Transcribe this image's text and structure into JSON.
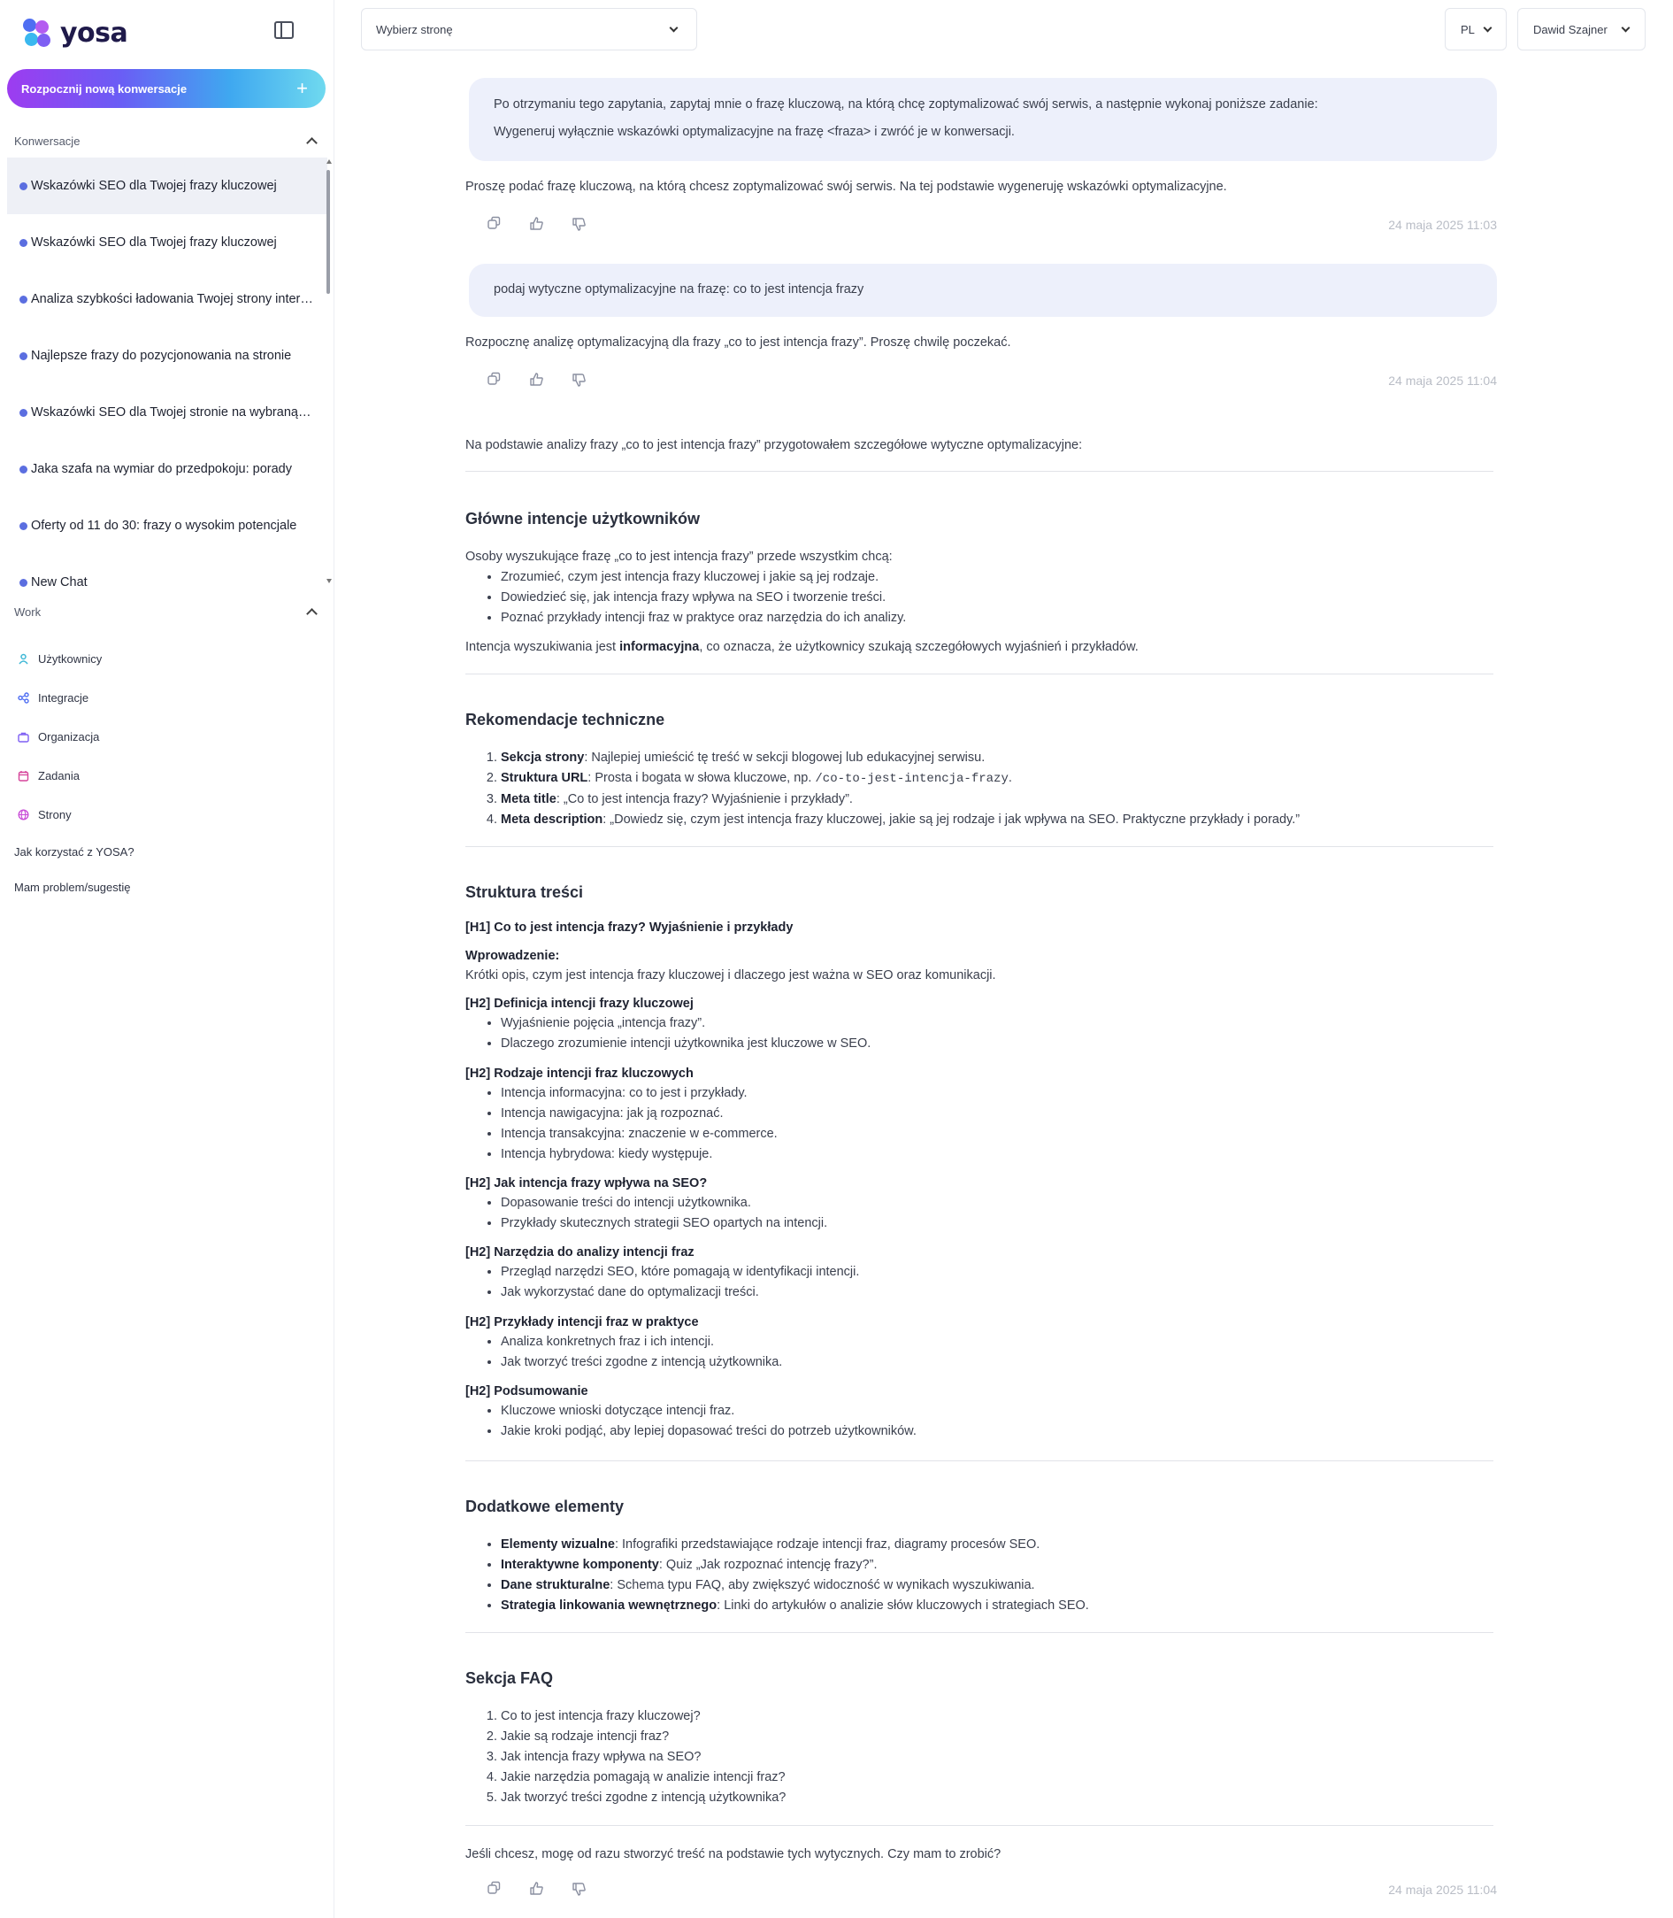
{
  "sidebar": {
    "logo_text": "yosa",
    "new_chat_label": "Rozpocznij nową konwersacje",
    "conversations_header": "Konwersacje",
    "conversations": [
      "Wskazówki SEO dla Twojej frazy kluczowej",
      "Wskazówki SEO dla Twojej frazy kluczowej",
      "Analiza szybkości ładowania Twojej strony internetowej",
      "Najlepsze frazy do pozycjonowania na stronie",
      "Wskazówki SEO dla Twojej stronie na wybraną frazę",
      "Jaka szafa na wymiar do przedpokoju: porady",
      "Oferty od 11 do 30: frazy o wysokim potencjale",
      "New Chat"
    ],
    "work_header": "Work",
    "work_items": [
      "Użytkownicy",
      "Integracje",
      "Organizacja",
      "Zadania",
      "Strony"
    ],
    "help_link": "Jak korzystać z YOSA?",
    "problem_link": "Mam problem/sugestię"
  },
  "header": {
    "page_select_placeholder": "Wybierz stronę",
    "lang": "PL",
    "user": "Dawid Szajner"
  },
  "chat": {
    "msg1_line1": "Po otrzymaniu tego zapytania, zapytaj mnie o frazę kluczową, na którą chcę zoptymalizować swój serwis, a następnie wykonaj poniższe zadanie:",
    "msg1_line2": "Wygeneruj wyłącznie wskazówki optymalizacyjne na frazę <fraza> i zwróć je w konwersacji.",
    "reply1": "Proszę podać frazę kluczową, na którą chcesz zoptymalizować swój serwis. Na tej podstawie wygeneruję wskazówki optymalizacyjne.",
    "time1": "24 maja 2025 11:03",
    "msg2": "podaj wytyczne optymalizacyjne na frazę: co to jest intencja frazy",
    "reply2": "Rozpocznę analizę optymalizacyjną dla frazy „co to jest intencja frazy”. Proszę chwilę poczekać.",
    "time2": "24 maja 2025 11:04",
    "intro": "Na podstawie analizy frazy „co to jest intencja frazy” przygotowałem szczegółowe wytyczne optymalizacyjne:",
    "s1_title": "Główne intencje użytkowników",
    "s1_lead": "Osoby wyszukujące frazę „co to jest intencja frazy” przede wszystkim chcą:",
    "s1_items": [
      "Zrozumieć, czym jest intencja frazy kluczowej i jakie są jej rodzaje.",
      "Dowiedzieć się, jak intencja frazy wpływa na SEO i tworzenie treści.",
      "Poznać przykłady intencji fraz w praktyce oraz narzędzia do ich analizy."
    ],
    "s1_tail_a": "Intencja wyszukiwania jest ",
    "s1_tail_b": "informacyjna",
    "s1_tail_c": ", co oznacza, że użytkownicy szukają szczegółowych wyjaśnień i przykładów.",
    "s2_title": "Rekomendacje techniczne",
    "s2_items": [
      {
        "k": "Sekcja strony",
        "v": ": Najlepiej umieścić tę treść w sekcji blogowej lub edukacyjnej serwisu."
      },
      {
        "k": "Struktura URL",
        "v": ": Prosta i bogata w słowa kluczowe, np. ",
        "code": "/co-to-jest-intencja-frazy",
        "end": "."
      },
      {
        "k": "Meta title",
        "v": ": „Co to jest intencja frazy? Wyjaśnienie i przykłady”."
      },
      {
        "k": "Meta description",
        "v": ": „Dowiedz się, czym jest intencja frazy kluczowej, jakie są jej rodzaje i jak wpływa na SEO. Praktyczne przykłady i porady.”"
      }
    ],
    "s3_title": "Struktura treści",
    "h1": "[H1] Co to jest intencja frazy? Wyjaśnienie i przykłady",
    "intro_label": "Wprowadzenie:",
    "intro_text": "Krótki opis, czym jest intencja frazy kluczowej i dlaczego jest ważna w SEO oraz komunikacji.",
    "h2_blocks": [
      {
        "title": "[H2] Definicja intencji frazy kluczowej",
        "items": [
          "Wyjaśnienie pojęcia „intencja frazy”.",
          "Dlaczego zrozumienie intencji użytkownika jest kluczowe w SEO."
        ]
      },
      {
        "title": "[H2] Rodzaje intencji fraz kluczowych",
        "items": [
          "Intencja informacyjna: co to jest i przykłady.",
          "Intencja nawigacyjna: jak ją rozpoznać.",
          "Intencja transakcyjna: znaczenie w e-commerce.",
          "Intencja hybrydowa: kiedy występuje."
        ]
      },
      {
        "title": "[H2] Jak intencja frazy wpływa na SEO?",
        "items": [
          "Dopasowanie treści do intencji użytkownika.",
          "Przykłady skutecznych strategii SEO opartych na intencji."
        ]
      },
      {
        "title": "[H2] Narzędzia do analizy intencji fraz",
        "items": [
          "Przegląd narzędzi SEO, które pomagają w identyfikacji intencji.",
          "Jak wykorzystać dane do optymalizacji treści."
        ]
      },
      {
        "title": "[H2] Przykłady intencji fraz w praktyce",
        "items": [
          "Analiza konkretnych fraz i ich intencji.",
          "Jak tworzyć treści zgodne z intencją użytkownika."
        ]
      },
      {
        "title": "[H2] Podsumowanie",
        "items": [
          "Kluczowe wnioski dotyczące intencji fraz.",
          "Jakie kroki podjąć, aby lepiej dopasować treści do potrzeb użytkowników."
        ]
      }
    ],
    "s4_title": "Dodatkowe elementy",
    "s4_items": [
      {
        "k": "Elementy wizualne",
        "v": ": Infografiki przedstawiające rodzaje intencji fraz, diagramy procesów SEO."
      },
      {
        "k": "Interaktywne komponenty",
        "v": ": Quiz „Jak rozpoznać intencję frazy?”."
      },
      {
        "k": "Dane strukturalne",
        "v": ": Schema typu FAQ, aby zwiększyć widoczność w wynikach wyszukiwania."
      },
      {
        "k": "Strategia linkowania wewnętrznego",
        "v": ": Linki do artykułów o analizie słów kluczowych i strategiach SEO."
      }
    ],
    "s5_title": "Sekcja FAQ",
    "s5_items": [
      "Co to jest intencja frazy kluczowej?",
      "Jakie są rodzaje intencji fraz?",
      "Jak intencja frazy wpływa na SEO?",
      "Jakie narzędzia pomagają w analizie intencji fraz?",
      "Jak tworzyć treści zgodne z intencją użytkownika?"
    ],
    "closing": "Jeśli chcesz, mogę od razu stworzyć treść na podstawie tych wytycznych. Czy mam to zrobić?",
    "time3": "24 maja 2025 11:04"
  },
  "colors": {
    "accent_gradient": [
      "#9d3cf0",
      "#6b5cf5",
      "#3fa8f0",
      "#6fd9ef"
    ],
    "bubble_bg": "#edf0fb",
    "dot": "#5b6ee0"
  }
}
